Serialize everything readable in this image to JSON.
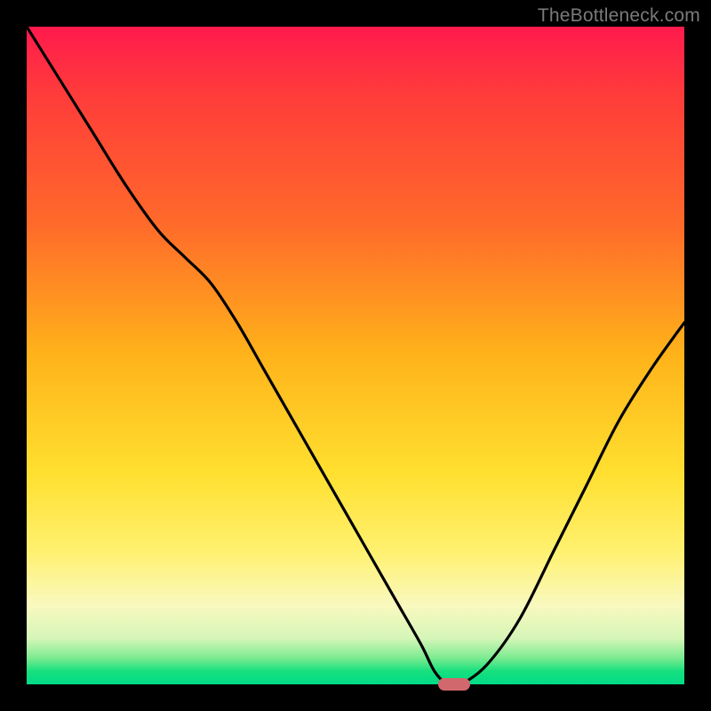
{
  "watermark": "TheBottleneck.com",
  "chart_data": {
    "type": "line",
    "title": "",
    "xlabel": "",
    "ylabel": "",
    "xlim": [
      0,
      100
    ],
    "ylim": [
      0,
      100
    ],
    "grid": false,
    "legend": false,
    "background_gradient": [
      "#ff1a4d",
      "#ff6a2a",
      "#ffe030",
      "#f9f9bf",
      "#00db86"
    ],
    "series": [
      {
        "name": "bottleneck-curve",
        "color": "#000000",
        "x": [
          0,
          5,
          10,
          15,
          20,
          24,
          28,
          32,
          36,
          40,
          44,
          48,
          52,
          56,
          60,
          62,
          64,
          66,
          70,
          75,
          80,
          85,
          90,
          95,
          100
        ],
        "y": [
          100,
          92,
          84,
          76,
          69,
          65,
          61,
          55,
          48,
          41,
          34,
          27,
          20,
          13,
          6,
          2,
          0,
          0,
          3,
          10,
          20,
          30,
          40,
          48,
          55
        ]
      }
    ],
    "marker": {
      "x": 65,
      "y": 0,
      "color": "#d1686d",
      "shape": "pill"
    }
  }
}
